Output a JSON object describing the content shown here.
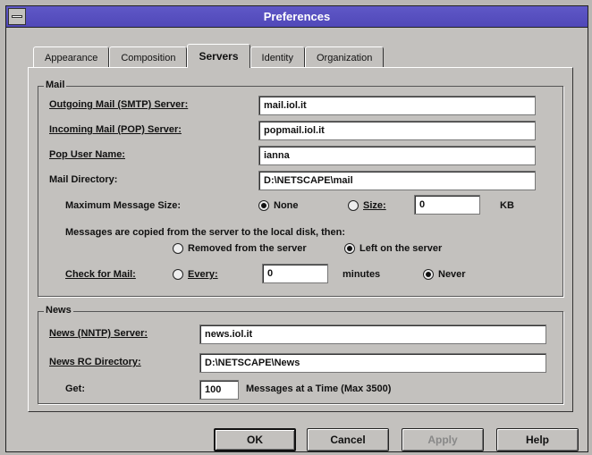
{
  "window": {
    "title": "Preferences"
  },
  "tabs": [
    {
      "label": "Appearance"
    },
    {
      "label": "Composition"
    },
    {
      "label": "Servers",
      "active": true
    },
    {
      "label": "Identity"
    },
    {
      "label": "Organization"
    }
  ],
  "mail": {
    "legend": "Mail",
    "smtp_label": "Outgoing Mail (SMTP) Server:",
    "smtp_value": "mail.iol.it",
    "pop_label": "Incoming Mail (POP) Server:",
    "pop_value": "popmail.iol.it",
    "user_label": "Pop User Name:",
    "user_value": "ianna",
    "dir_label": "Mail Directory:",
    "dir_value": "D:\\NETSCAPE\\mail",
    "maxsize_label": "Maximum Message Size:",
    "none_label": "None",
    "size_label": "Size:",
    "size_value": "0",
    "kb_label": "KB",
    "copied_label": "Messages are copied from the server to the local disk, then:",
    "removed_label": "Removed from the server",
    "left_label": "Left on the server",
    "check_label": "Check for Mail:",
    "every_label": "Every:",
    "every_value": "0",
    "minutes_label": "minutes",
    "never_label": "Never",
    "maxsize_selected": "None",
    "after_copy_selected": "Left on the server",
    "check_selected": "Never"
  },
  "news": {
    "legend": "News",
    "nntp_label": "News (NNTP) Server:",
    "nntp_value": "news.iol.it",
    "rc_label": "News RC Directory:",
    "rc_value": "D:\\NETSCAPE\\News",
    "get_label": "Get:",
    "get_value": "100",
    "get_suffix": "Messages at a Time (Max 3500)"
  },
  "buttons": {
    "ok": "OK",
    "cancel": "Cancel",
    "apply": "Apply",
    "help": "Help"
  },
  "colors": {
    "titlebar": "#5048b8",
    "face": "#c3c1be"
  }
}
